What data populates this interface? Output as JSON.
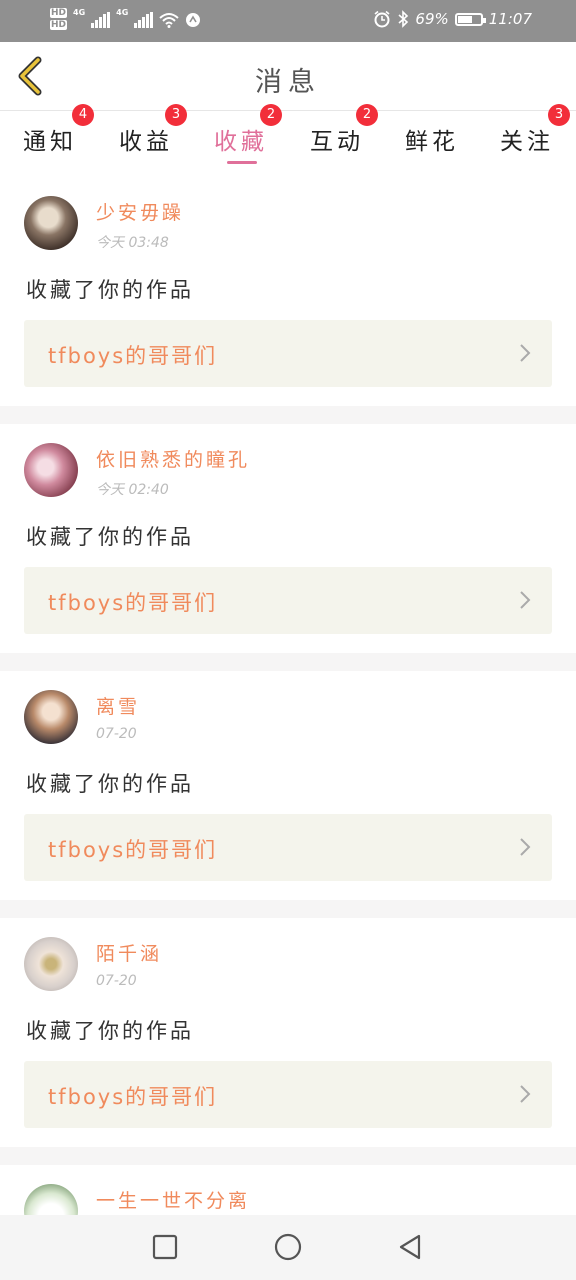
{
  "status_bar": {
    "hd1": "HD",
    "hd2": "HD",
    "net1": "4G",
    "net2": "4G",
    "battery_text": "69%",
    "battery_level": 0.69,
    "time": "11:07"
  },
  "header": {
    "title": "消息"
  },
  "tabs": [
    {
      "label": "通知",
      "badge": "4"
    },
    {
      "label": "收益",
      "badge": "3"
    },
    {
      "label": "收藏",
      "badge": "2",
      "active": true
    },
    {
      "label": "互动",
      "badge": "2"
    },
    {
      "label": "鲜花",
      "badge": ""
    },
    {
      "label": "关注",
      "badge": "3"
    }
  ],
  "feed": [
    {
      "name": "少安毋躁",
      "time": "今天 03:48",
      "action": "收藏了你的作品",
      "work": "tfboys的哥哥们"
    },
    {
      "name": "依旧熟悉的瞳孔",
      "time": "今天 02:40",
      "action": "收藏了你的作品",
      "work": "tfboys的哥哥们"
    },
    {
      "name": "离雪",
      "time": "07-20",
      "action": "收藏了你的作品",
      "work": "tfboys的哥哥们"
    },
    {
      "name": "陌千涵",
      "time": "07-20",
      "action": "收藏了你的作品",
      "work": "tfboys的哥哥们"
    },
    {
      "name": "一生一世不分离",
      "time": "",
      "action": "",
      "work": ""
    }
  ],
  "colors": {
    "accent": "#e0709a",
    "name_color": "#f08a5c",
    "badge": "#f22e3a",
    "card_bg": "#f4f4ec",
    "back_icon": "#e8c33a"
  }
}
